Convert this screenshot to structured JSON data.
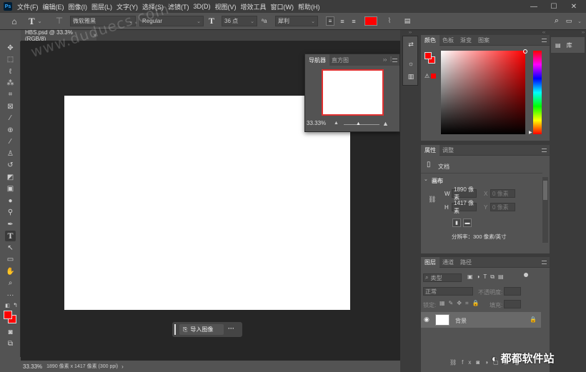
{
  "menubar": {
    "items": [
      "文件(F)",
      "编辑(E)",
      "图像(I)",
      "图层(L)",
      "文字(Y)",
      "选择(S)",
      "滤镜(T)",
      "3D(D)",
      "视图(V)",
      "增效工具",
      "窗口(W)",
      "帮助(H)"
    ],
    "minimize": "—",
    "maximize": "☐",
    "close": "✕"
  },
  "options": {
    "font_family": "微软雅黑",
    "font_style": "Regular",
    "font_size": "36 点",
    "antialias": "犀利",
    "text_color": "#ff0000"
  },
  "document": {
    "tab_title": "HBS.psd @ 33.3%(RGB/8)",
    "close": "×"
  },
  "navigator": {
    "tab_active": "导航器",
    "tab_other": "直方图",
    "zoom": "33.33%"
  },
  "import_button": "导入图像",
  "import_more": "···",
  "status": {
    "zoom": "33.33%",
    "info": "1890 像素 x 1417 像素 (300 ppi)",
    "arrow": "›"
  },
  "color_panel": {
    "tabs": [
      "颜色",
      "色板",
      "渐变",
      "图案"
    ],
    "foreground": "#ff0000",
    "background": "#ff0000"
  },
  "properties_panel": {
    "tabs": [
      "属性",
      "调整"
    ],
    "doc_label": "文档",
    "section": "画布",
    "w_label": "W",
    "w_value": "1890 像素",
    "h_label": "H",
    "h_value": "1417 像素",
    "x_label": "X",
    "x_placeholder": "0 像素",
    "y_label": "Y",
    "y_placeholder": "0 像素",
    "resolution": "分辨率：300 像素/英寸"
  },
  "layers_panel": {
    "tabs": [
      "图层",
      "通道",
      "路径"
    ],
    "filter_kind": "类型",
    "blend_mode": "正常",
    "opacity_label": "不透明度:",
    "lock_label": "锁定:",
    "fill_label": "填充:",
    "layer_name": "背景"
  },
  "library": {
    "label": "库"
  },
  "watermark_text": "www.duduecs.com",
  "brand_watermark": "都都软件站"
}
